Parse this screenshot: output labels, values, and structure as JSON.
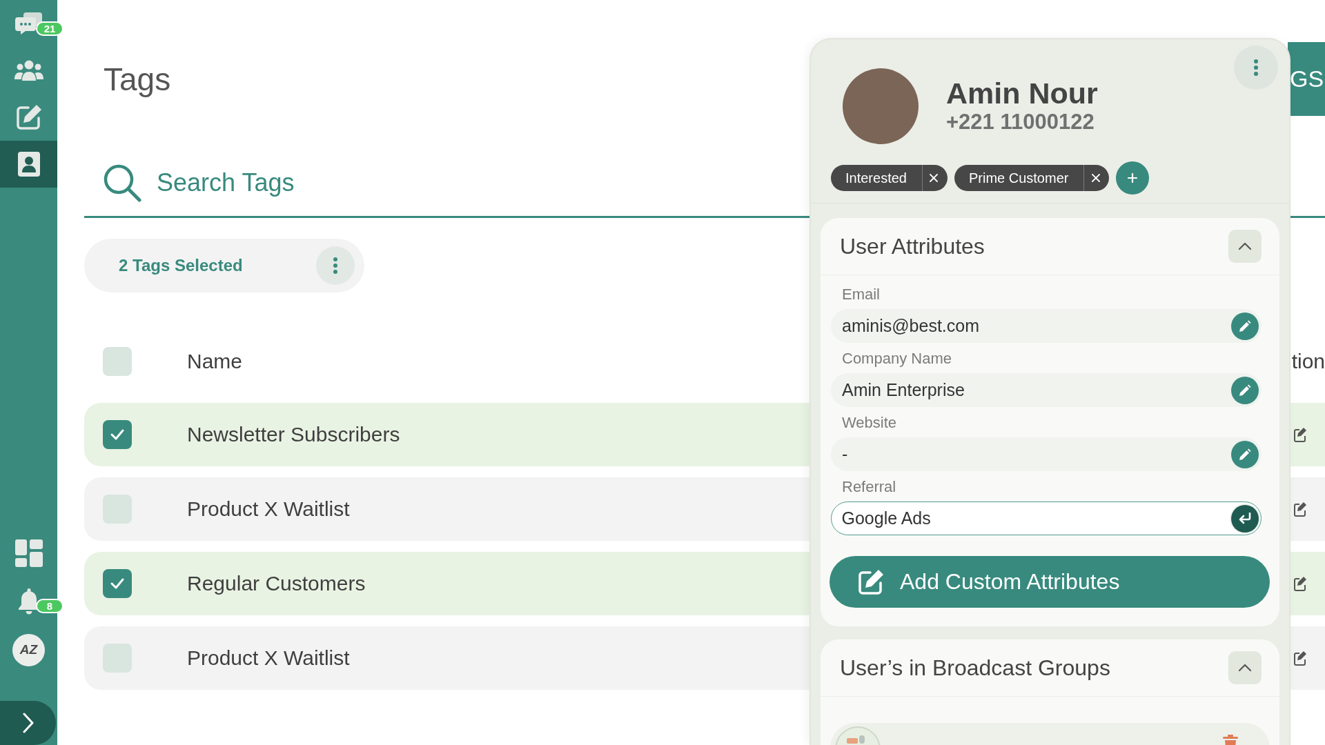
{
  "sidebar": {
    "items": [
      {
        "kind": "chat",
        "badge": "21",
        "selected": false
      },
      {
        "kind": "people",
        "selected": false
      },
      {
        "kind": "compose",
        "selected": false
      },
      {
        "kind": "contact",
        "selected": true
      }
    ],
    "bottom_items": [
      {
        "kind": "dashboard",
        "selected": false
      },
      {
        "kind": "bell",
        "badge": "8",
        "selected": false
      }
    ],
    "logo": "AZ"
  },
  "page": {
    "title": "Tags",
    "header_button": "GS"
  },
  "search": {
    "placeholder": "Search Tags"
  },
  "selection": {
    "label": "2 Tags Selected"
  },
  "table": {
    "select_all": {
      "checked": false
    },
    "columns": [
      "Name",
      "tion"
    ],
    "rows": [
      {
        "name": "Newsletter Subscribers",
        "selected": true
      },
      {
        "name": "Product X Waitlist",
        "selected": false
      },
      {
        "name": "Regular Customers",
        "selected": true
      },
      {
        "name": "Product X Waitlist",
        "selected": false
      }
    ]
  },
  "contact_panel": {
    "name": "Amin Nour",
    "phone": "+221 11000122",
    "tags": [
      {
        "label": "Interested"
      },
      {
        "label": "Prime Customer"
      }
    ],
    "sections": [
      {
        "title": "User Attributes",
        "expanded": true,
        "fields": [
          {
            "label": "Email",
            "value": "aminis@best.com",
            "editing": false
          },
          {
            "label": "Company Name",
            "value": "Amin Enterprise",
            "editing": false
          },
          {
            "label": "Website",
            "value": "-",
            "editing": false
          },
          {
            "label": "Referral",
            "value": "Google Ads",
            "editing": true
          }
        ],
        "button": "Add Custom Attributes"
      },
      {
        "title": "User’s in Broadcast Groups",
        "expanded": true,
        "items": [
          {
            "kind": "group"
          }
        ]
      }
    ]
  }
}
